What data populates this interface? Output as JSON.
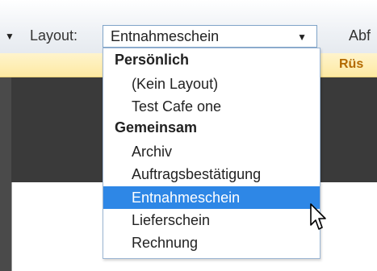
{
  "toolbar": {
    "left_select_arrow": "▼",
    "layout_label": "Layout:",
    "layout_select_value": "Entnahmeschein",
    "layout_select_arrow": "▼",
    "next_label": "Abf"
  },
  "orange_bar": {
    "label": "Rüs"
  },
  "dropdown": {
    "groups": [
      {
        "label": "Persönlich",
        "items": [
          "(Kein Layout)",
          "Test Cafe one"
        ]
      },
      {
        "label": "Gemeinsam",
        "items": [
          "Archiv",
          "Auftragsbestätigung",
          "Entnahmeschein",
          "Lieferschein",
          "Rechnung"
        ]
      }
    ],
    "selected_item": "Entnahmeschein"
  },
  "colors": {
    "selection_highlight": "#2e87e6",
    "orange_bar_text": "#b36a00",
    "dark_background": "#3a3a3a"
  },
  "icons": {
    "cursor": "arrow-pointer-icon"
  }
}
